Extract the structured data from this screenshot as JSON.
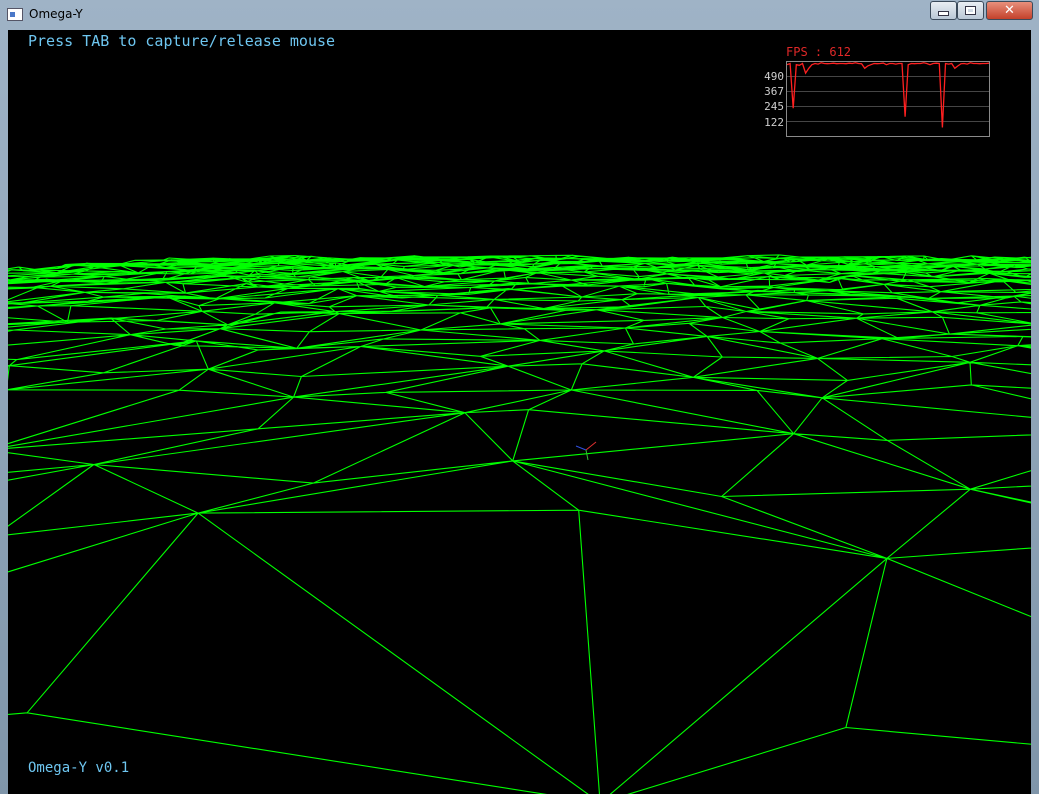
{
  "window": {
    "title": "Omega-Y",
    "close_glyph": "✕"
  },
  "viewport": {
    "hint": "Press TAB to capture/release mouse",
    "version": "Omega-Y v0.1",
    "wire_color": "#00ff00"
  },
  "fps_graph": {
    "label": "FPS : 612",
    "ticks": [
      "490",
      "367",
      "245",
      "122"
    ],
    "color": "#ff2020",
    "grid_color": "#8a8a8a"
  },
  "chart_data": {
    "type": "line",
    "title": "FPS : 612",
    "ylabel": "",
    "xlabel": "",
    "ylim": [
      0,
      612
    ],
    "y_ticks": [
      490,
      367,
      245,
      122
    ],
    "series": [
      {
        "values": [
          590,
          600,
          230,
          590,
          585,
          600,
          520,
          560,
          590,
          600,
          595,
          605,
          600,
          598,
          600,
          602,
          598,
          600,
          600,
          598,
          602,
          600,
          605,
          600,
          598,
          560,
          580,
          590,
          600,
          598,
          600,
          603,
          590,
          600,
          600,
          595,
          600,
          600,
          160,
          590,
          600,
          598,
          600,
          600,
          605,
          600,
          590,
          600,
          602,
          600,
          70,
          600,
          595,
          600,
          560,
          580,
          598,
          600,
          595,
          605,
          600,
          600,
          598,
          600,
          600,
          602
        ]
      }
    ]
  }
}
